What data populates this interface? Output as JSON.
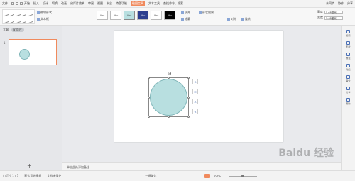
{
  "menubar": {
    "file": "文件",
    "items": [
      "开始",
      "插入",
      "设计",
      "切换",
      "动画",
      "幻灯片放映",
      "审阅",
      "视图",
      "安全",
      "特色功能"
    ],
    "active": "绘图工具",
    "text_tool": "文本工具",
    "search": "查找命令、搜索",
    "right": [
      "未同步",
      "协作",
      "分享"
    ]
  },
  "ribbon": {
    "edit_shape": "编辑形状",
    "text_box": "文本框",
    "styles": [
      "Abc",
      "Abc",
      "Abc",
      "Abc",
      "Abc",
      "Abc"
    ],
    "fill": "填充",
    "outline": "轮廓",
    "shape_effect": "形状效果",
    "combine": "对齐",
    "rotate": "旋转",
    "height_label": "高度",
    "height_value": "5.68厘米",
    "width_label": "宽度",
    "width_value": "5.68厘米"
  },
  "leftpanel": {
    "tab1": "大纲",
    "tab2": "幻灯片",
    "slide_num": "1",
    "add": "+"
  },
  "floattools": [
    "⊖",
    "⬠",
    "⎍",
    "✎"
  ],
  "notes": "单击此处添加备注",
  "rightbar": [
    "选项",
    "形状",
    "属性",
    "动画",
    "备份",
    "分享",
    "帮助"
  ],
  "status": {
    "slide": "幻灯片 1 / 1",
    "theme": "默认设计模板",
    "protect": "文档未保护",
    "beautify": "一键美化",
    "zoom": "67%"
  },
  "watermark": "Baidu 经验",
  "colors": {
    "accent": "#f08a5d",
    "shape_fill": "#b8dfe0",
    "shape_stroke": "#7fb5b8"
  }
}
